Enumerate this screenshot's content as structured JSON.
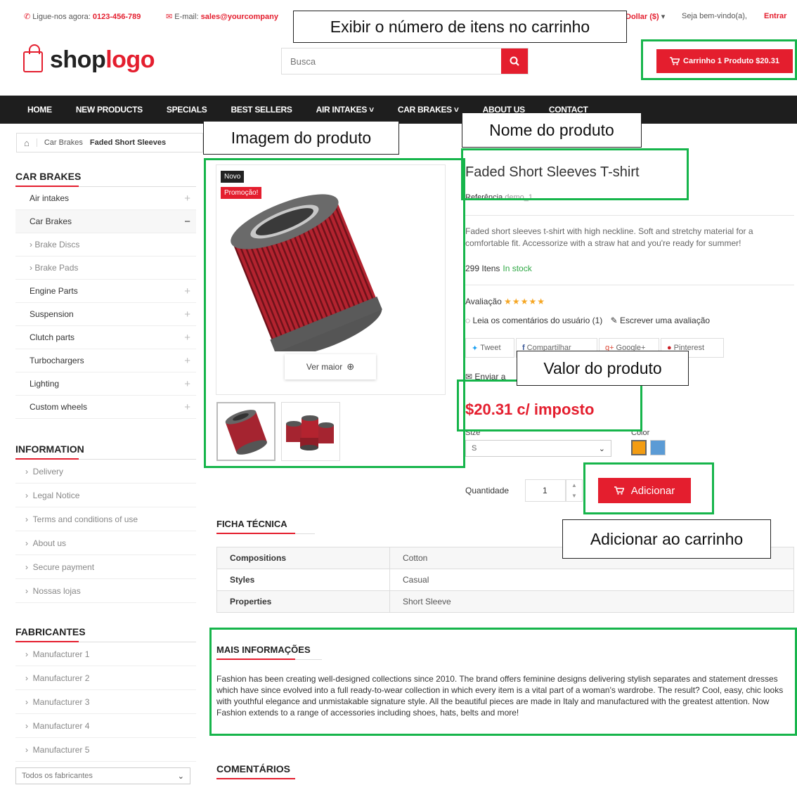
{
  "topbar": {
    "phone_label": "Ligue-nos agora:",
    "phone": "0123-456-789",
    "email_label": "E-mail:",
    "email": "sales@yourcompany",
    "currency": "Dollar ($)",
    "welcome": "Seja bem-vindo(a),",
    "login": "Entrar"
  },
  "logo": {
    "part1": "shop",
    "part2": "logo"
  },
  "search": {
    "placeholder": "Busca"
  },
  "cart": {
    "label": "Carrinho 1 Produto $20.31"
  },
  "nav": {
    "items": [
      "HOME",
      "NEW PRODUCTS",
      "SPECIALS",
      "BEST SELLERS",
      "AIR INTAKES ˅",
      "CAR BRAKES ˅",
      "ABOUT US",
      "CONTACT"
    ]
  },
  "breadcrumb": {
    "items": [
      "Car Brakes",
      "Faded Short Sleeves"
    ]
  },
  "sidebar": {
    "car_brakes_title": "CAR BRAKES",
    "categories": [
      {
        "label": "Air intakes",
        "sign": "+"
      },
      {
        "label": "Car Brakes",
        "sign": "−"
      },
      {
        "label": "› Brake Discs",
        "sign": ""
      },
      {
        "label": "› Brake Pads",
        "sign": ""
      },
      {
        "label": "Engine Parts",
        "sign": "+"
      },
      {
        "label": "Suspension",
        "sign": "+"
      },
      {
        "label": "Clutch parts",
        "sign": "+"
      },
      {
        "label": "Turbochargers",
        "sign": "+"
      },
      {
        "label": "Lighting",
        "sign": "+"
      },
      {
        "label": "Custom wheels",
        "sign": "+"
      }
    ],
    "info_title": "INFORMATION",
    "info_links": [
      "Delivery",
      "Legal Notice",
      "Terms and conditions of use",
      "About us",
      "Secure payment",
      "Nossas lojas"
    ],
    "manu_title": "FABRICANTES",
    "manu_links": [
      "Manufacturer 1",
      "Manufacturer 2",
      "Manufacturer 3",
      "Manufacturer 4",
      "Manufacturer 5"
    ],
    "manu_select": "Todos os fabricantes"
  },
  "callouts": {
    "cart_count": "Exibir o número de itens no carrinho",
    "image": "Imagem do produto",
    "name": "Nome do produto",
    "price": "Valor do produto",
    "add": "Adicionar ao carrinho"
  },
  "product": {
    "badge_new": "Novo",
    "badge_sale": "Promoção!",
    "zoom": "Ver maior",
    "title": "Faded Short Sleeves T-shirt",
    "reference_label": "Referência",
    "reference": "demo_1",
    "description": "Faded short sleeves t-shirt with high neckline. Soft and stretchy material for a comfortable fit. Accessorize with a straw hat and you're ready for summer!",
    "stock_count": "299 Itens",
    "stock_status": "In stock",
    "rating_label": "Avaliação",
    "stars": "★★★★★",
    "read_comments": "Leia os comentários do usuário (1)",
    "write_review": "Escrever uma avaliação",
    "share": [
      "Tweet",
      "Compartilhar",
      "Google+",
      "Pinterest"
    ],
    "send": "Enviar a",
    "price": "$20.31 c/ imposto",
    "size_label": "Size",
    "size_value": "S",
    "color_label": "Color",
    "colors": [
      "#f39c12",
      "#5b9bd5"
    ],
    "qty_label": "Quantidade",
    "qty_value": "1",
    "add_button": "Adicionar"
  },
  "spec": {
    "title": "FICHA TÉCNICA",
    "rows": [
      {
        "key": "Compositions",
        "value": "Cotton"
      },
      {
        "key": "Styles",
        "value": "Casual"
      },
      {
        "key": "Properties",
        "value": "Short Sleeve"
      }
    ]
  },
  "more_info": {
    "title": "MAIS INFORMAÇÕES",
    "text": "Fashion has been creating well-designed collections since 2010. The brand offers feminine designs delivering stylish separates and statement dresses which have since evolved into a full ready-to-wear collection in which every item is a vital part of a woman's wardrobe. The result? Cool, easy, chic looks with youthful elegance and unmistakable signature style. All the beautiful pieces are made in Italy and manufactured with the greatest attention. Now Fashion extends to a range of accessories including shoes, hats, belts and more!"
  },
  "comments_title": "COMENTÁRIOS"
}
